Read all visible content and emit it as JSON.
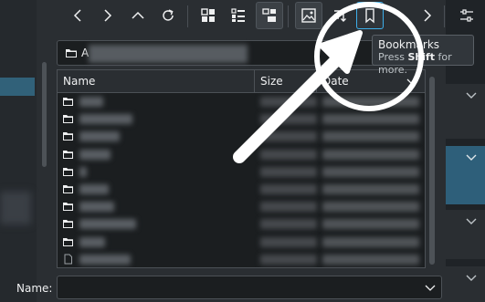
{
  "toolbar": {
    "buttons": [
      {
        "name": "back",
        "icon": "chevron-left-icon"
      },
      {
        "name": "forward",
        "icon": "chevron-right-icon"
      },
      {
        "name": "up",
        "icon": "chevron-up-icon"
      },
      {
        "name": "reload",
        "icon": "reload-icon"
      },
      {
        "name": "icons-view",
        "icon": "grid-view-icon"
      },
      {
        "name": "compact-view",
        "icon": "compact-view-icon"
      },
      {
        "name": "detailed-tree-view",
        "icon": "tree-view-icon",
        "checked": true
      },
      {
        "name": "preview",
        "icon": "image-preview-icon",
        "checked": true
      },
      {
        "name": "sort",
        "icon": "sort-icon"
      },
      {
        "name": "bookmarks",
        "icon": "bookmark-icon",
        "focused": true
      },
      {
        "name": "more",
        "icon": "chevron-right-icon"
      },
      {
        "name": "options",
        "icon": "sliders-icon"
      }
    ]
  },
  "tooltip": {
    "title": "Bookmarks",
    "hint_prefix": "Press ",
    "hint_key": "Shift",
    "hint_suffix": " for more."
  },
  "pathbar": {
    "path_visible": "A"
  },
  "filelist": {
    "columns": [
      "Name",
      "Size",
      "Date"
    ],
    "rows": [
      {
        "type": "folder"
      },
      {
        "type": "folder"
      },
      {
        "type": "folder"
      },
      {
        "type": "folder"
      },
      {
        "type": "folder"
      },
      {
        "type": "folder"
      },
      {
        "type": "folder"
      },
      {
        "type": "folder"
      },
      {
        "type": "folder"
      },
      {
        "type": "file"
      },
      {
        "type": "file"
      }
    ]
  },
  "name_field": {
    "label": "Name:",
    "value": ""
  },
  "colors": {
    "accent": "#3daee9",
    "background": "#2a2e32",
    "field_background": "#1b1e20",
    "annotation": "#ffffff"
  }
}
